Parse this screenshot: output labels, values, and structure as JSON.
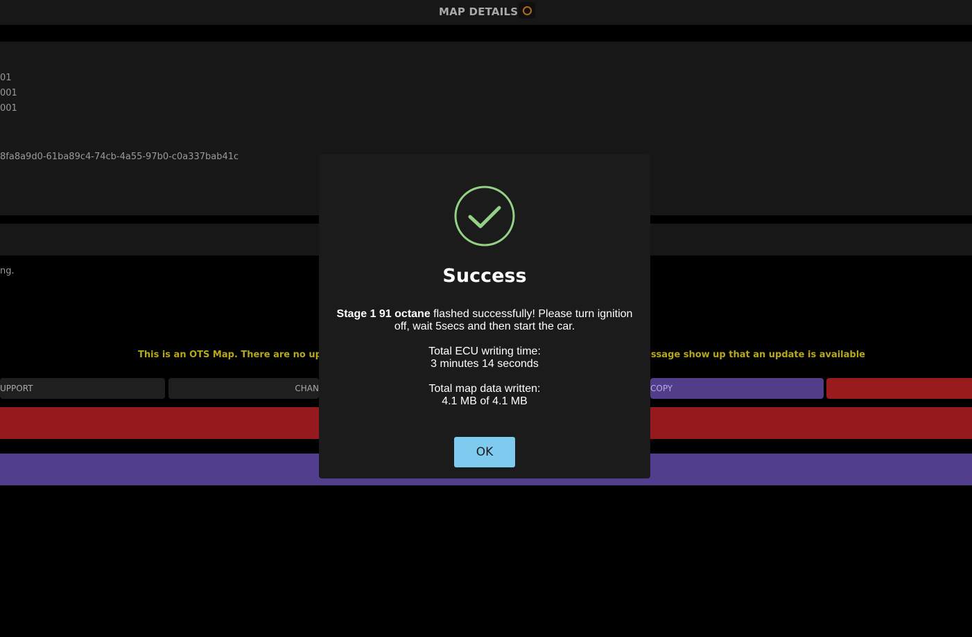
{
  "header": {
    "title": "MAP DETAILS"
  },
  "details": {
    "line_a": "01",
    "line_b": "001",
    "line_c": "001",
    "uuid": "8fa8a9d0-61ba89c4-74cb-4a55-97b0-c0a337bab41c"
  },
  "note": {
    "text": "ng."
  },
  "ots": {
    "left_text": "This is an OTS Map. There are no updates",
    "right_text": "message show up that an update is available."
  },
  "buttons": {
    "support_label": "UPPORT",
    "change_label": "CHAN",
    "copy_label": "COPY"
  },
  "modal": {
    "icon": "check-circle-icon",
    "title": "Success",
    "map_name": "Stage 1 91 octane",
    "message_rest": " flashed successfully! Please turn ignition off, wait 5secs and then start the car.",
    "time_label": "Total ECU writing time:",
    "time_value": "3 minutes 14 seconds",
    "data_label": "Total map data written:",
    "data_value": "4.1 MB of 4.1 MB",
    "ok_label": "OK"
  },
  "colors": {
    "success_green": "#95d185",
    "ok_button": "#7fcbf0",
    "warning_text": "#b7a81a",
    "danger_red": "#961a1d",
    "purple": "#513e8c"
  }
}
